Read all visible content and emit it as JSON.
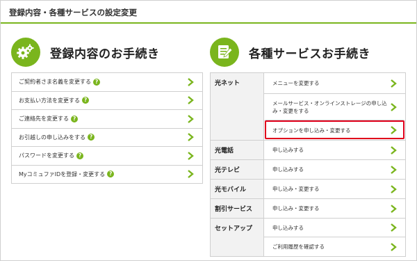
{
  "page": {
    "title": "登録内容・各種サービスの設定変更"
  },
  "registration": {
    "title": "登録内容のお手続き",
    "icon": "gears-icon",
    "items": [
      {
        "label": "ご契約者さま名義を変更する"
      },
      {
        "label": "お支払い方法を変更する"
      },
      {
        "label": "ご連絡先を変更する"
      },
      {
        "label": "お引越しの申し込みをする"
      },
      {
        "label": "パスワードを変更する"
      },
      {
        "label": "MyコミュファIDを登録・変更する"
      }
    ]
  },
  "services": {
    "title": "各種サービスお手続き",
    "icon": "document-pen-icon",
    "groups": [
      {
        "category": "光ネット",
        "items": [
          {
            "label": "メニューを変更する"
          },
          {
            "label": "メールサービス・オンラインストレージの申し込み・変更をする"
          },
          {
            "label": "オプションを申し込み・変更する"
          }
        ]
      },
      {
        "category": "光電話",
        "items": [
          {
            "label": "申し込みする"
          }
        ]
      },
      {
        "category": "光テレビ",
        "items": [
          {
            "label": "申し込みする"
          }
        ]
      },
      {
        "category": "光モバイル",
        "items": [
          {
            "label": "申し込み・変更する"
          }
        ]
      },
      {
        "category": "割引サービス",
        "items": [
          {
            "label": "申し込み・変更する"
          }
        ]
      },
      {
        "category": "セットアップ",
        "items": [
          {
            "label": "申し込みする"
          },
          {
            "label": "ご利用履歴を確認する"
          }
        ]
      }
    ]
  },
  "colors": {
    "accent": "#7ab51d",
    "highlight": "#e0001b",
    "help_mark": "?"
  }
}
